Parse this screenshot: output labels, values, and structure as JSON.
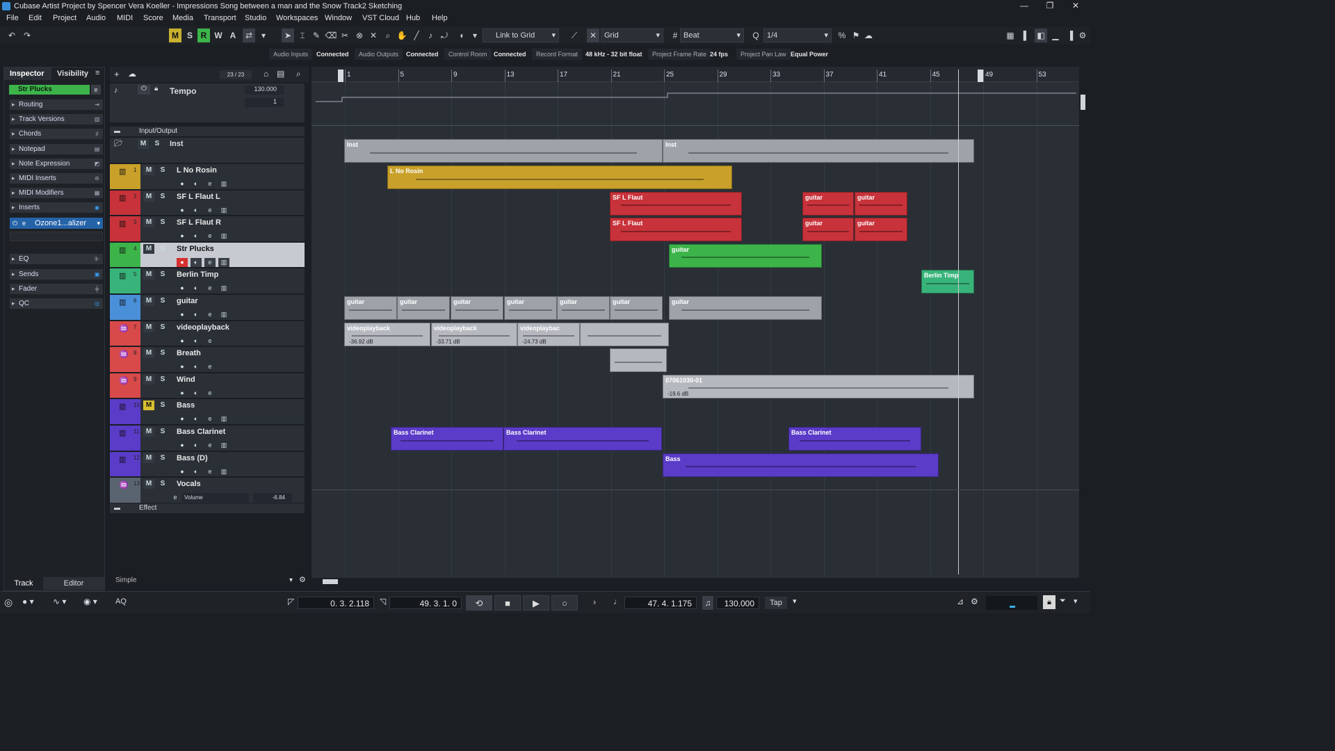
{
  "window": {
    "title": "Cubase Artist Project by Spencer Vera Koeller - Impressions Song between a man and the Snow Track2 Sketching"
  },
  "menu": [
    "File",
    "Edit",
    "Project",
    "Audio",
    "MIDI",
    "Score",
    "Media",
    "Transport",
    "Studio",
    "Workspaces",
    "Window",
    "VST Cloud",
    "Hub",
    "Help"
  ],
  "toolbar": {
    "mode_buttons": [
      "M",
      "S",
      "R",
      "W",
      "A"
    ],
    "link_label": "Link to Grid",
    "grid_label": "Grid",
    "beat_label": "Beat",
    "quantize_label": "1/4"
  },
  "status": {
    "audio_inputs_label": "Audio Inputs",
    "audio_inputs_value": "Connected",
    "audio_outputs_label": "Audio Outputs",
    "audio_outputs_value": "Connected",
    "control_room_label": "Control Room",
    "control_room_value": "Connected",
    "record_format_label": "Record Format",
    "record_format_value": "48 kHz - 32 bit float",
    "frame_rate_label": "Project Frame Rate",
    "frame_rate_value": "24 fps",
    "pan_law_label": "Project Pan Law",
    "pan_law_value": "Equal Power"
  },
  "inspector": {
    "tab_inspector": "Inspector",
    "tab_visibility": "Visibility",
    "track_name": "Str Plucks",
    "sections": [
      "Routing",
      "Track Versions",
      "Chords",
      "Notepad",
      "Note Expression",
      "MIDI Inserts",
      "MIDI Modifiers",
      "Inserts"
    ],
    "insert_plugin": "Ozone1...alizer",
    "sections2": [
      "EQ",
      "Sends",
      "Fader",
      "QC"
    ],
    "bottom_tab_track": "Track",
    "bottom_tab_editor": "Editor"
  },
  "tracklist": {
    "counter": "23 / 23",
    "tempo_label": "Tempo",
    "tempo_value": "130.000",
    "tempo_sub": "1",
    "folder_label": "Input/Output",
    "inst_folder": "Inst",
    "preset": "Simple",
    "effect_label": "Effect",
    "vocals_volume_label": "Volume",
    "vocals_volume_value": "-6.84",
    "tracks": [
      {
        "num": "1",
        "name": "L No Rosin",
        "color": "#c8a02a"
      },
      {
        "num": "2",
        "name": "SF L Flaut L",
        "color": "#c8323a"
      },
      {
        "num": "3",
        "name": "SF L Flaut R",
        "color": "#c8323a"
      },
      {
        "num": "4",
        "name": "Str Plucks",
        "color": "#3cb44a"
      },
      {
        "num": "5",
        "name": "Berlin Timp",
        "color": "#38b47a"
      },
      {
        "num": "6",
        "name": "guitar",
        "color": "#4a90d8"
      },
      {
        "num": "7",
        "name": "videoplayback",
        "color": "#d84a4a"
      },
      {
        "num": "8",
        "name": "Breath",
        "color": "#d84a4a"
      },
      {
        "num": "9",
        "name": "Wind",
        "color": "#d84a4a"
      },
      {
        "num": "10",
        "name": "Bass",
        "color": "#5a3cc8"
      },
      {
        "num": "11",
        "name": "Bass Clarinet",
        "color": "#5a3cc8"
      },
      {
        "num": "12",
        "name": "Bass (D)",
        "color": "#5a3cc8"
      },
      {
        "num": "13",
        "name": "Vocals",
        "color": "#5a6470"
      }
    ]
  },
  "ruler": {
    "bars": [
      "1",
      "5",
      "9",
      "13",
      "17",
      "21",
      "25",
      "29",
      "33",
      "37",
      "41",
      "45",
      "49",
      "53"
    ]
  },
  "events": {
    "inst": "Inst",
    "no_rosin": "L No Rosin",
    "sf_flaut": "SF L Flaut",
    "guitar": "guitar",
    "berlin": "Berlin Timp",
    "video": "videoplayback",
    "video_trunc": "videoplaybac",
    "db1": "-36.92 dB",
    "db2": "-33.71 dB",
    "db3": "-24.73 dB",
    "wind_clip": "07061030-01",
    "wind_db": "-19.6 dB",
    "bass_clar": "Bass Clarinet",
    "bass": "Bass"
  },
  "transport": {
    "left_locator": "0. 3. 2.118",
    "right_locator": "49. 3. 1. 0",
    "position": "47. 4. 1.175",
    "tempo": "130.000",
    "tap": "Tap",
    "aq": "AQ"
  }
}
